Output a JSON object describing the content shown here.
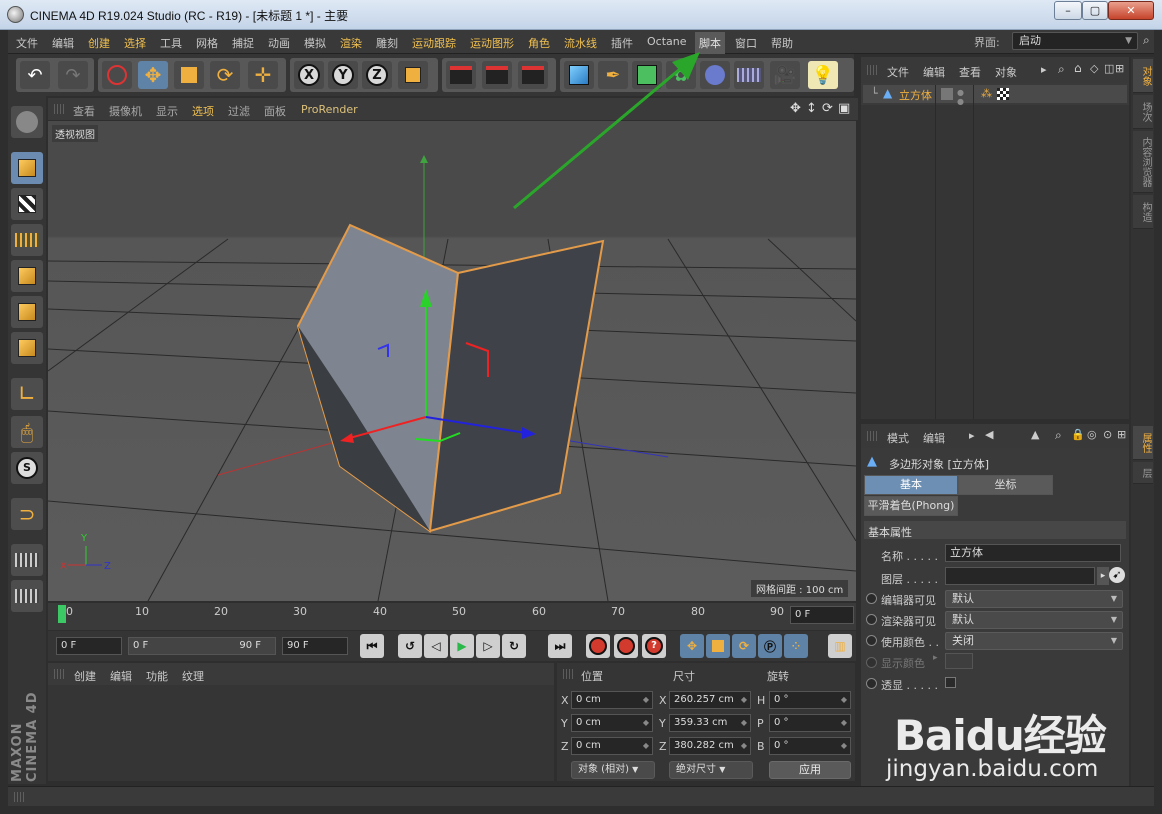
{
  "window": {
    "title": "CINEMA 4D R19.024 Studio (RC - R19) - [未标题 1 *] - 主要",
    "minimize": "–",
    "maximize": "▢",
    "close": "✕"
  },
  "menubar": {
    "items": [
      "文件",
      "编辑",
      "创建",
      "选择",
      "工具",
      "网格",
      "捕捉",
      "动画",
      "模拟",
      "渲染",
      "雕刻",
      "运动跟踪",
      "运动图形",
      "角色",
      "流水线",
      "插件",
      "Octane",
      "脚本",
      "窗口",
      "帮助"
    ],
    "layout_label": "界面:",
    "layout_value": "启动"
  },
  "viewport": {
    "menu": [
      "查看",
      "摄像机",
      "显示",
      "选项",
      "过滤",
      "面板",
      "ProRender"
    ],
    "label": "透视视图",
    "grid_spacing": "网格间距 : 100 cm",
    "axis_labels": {
      "y": "Y",
      "x": "X",
      "z": "Z"
    }
  },
  "timeline": {
    "ticks": [
      "0",
      "10",
      "20",
      "30",
      "40",
      "50",
      "60",
      "70",
      "80",
      "90"
    ],
    "current_frame": "0 F"
  },
  "playback": {
    "start": "0 F",
    "range_start": "0 F",
    "range_end": "90 F",
    "end": "90 F"
  },
  "material_manager": {
    "menu": [
      "创建",
      "编辑",
      "功能",
      "纹理"
    ]
  },
  "coordinates": {
    "headers": [
      "位置",
      "尺寸",
      "旋转"
    ],
    "rows": [
      {
        "pos_axis": "X",
        "pos": "0 cm",
        "size_axis": "X",
        "size": "260.257 cm",
        "rot_axis": "H",
        "rot": "0 °"
      },
      {
        "pos_axis": "Y",
        "pos": "0 cm",
        "size_axis": "Y",
        "size": "359.33 cm",
        "rot_axis": "P",
        "rot": "0 °"
      },
      {
        "pos_axis": "Z",
        "pos": "0 cm",
        "size_axis": "Z",
        "size": "380.282 cm",
        "rot_axis": "B",
        "rot": "0 °"
      }
    ],
    "mode": "对象 (相对)",
    "size_mode": "绝对尺寸",
    "apply": "应用"
  },
  "object_manager": {
    "menu": [
      "文件",
      "编辑",
      "查看",
      "对象"
    ],
    "object_name": "立方体"
  },
  "attribute_manager": {
    "menu": [
      "模式",
      "编辑"
    ],
    "object_type": "多边形对象 [立方体]",
    "tabs": [
      "基本",
      "坐标"
    ],
    "phong_tab": "平滑着色(Phong)",
    "section": "基本属性",
    "fields": {
      "name_label": "名称 . . . . .",
      "name_value": "立方体",
      "layer_label": "图层 . . . . .",
      "editor_vis_label": "编辑器可见",
      "editor_vis_value": "默认",
      "render_vis_label": "渲染器可见",
      "render_vis_value": "默认",
      "use_color_label": "使用颜色 . .",
      "use_color_value": "关闭",
      "display_color_label": "显示颜色",
      "xray_label": "透显 . . . . ."
    }
  },
  "right_tabs": [
    "对象",
    "场次",
    "内容浏览器",
    "构造",
    "属性",
    "层"
  ],
  "logo": "MAXON CINEMA 4D",
  "watermark": {
    "brand": "Baidu经验",
    "url": "jingyan.baidu.com"
  },
  "colors": {
    "accent": "#f0b040",
    "selection": "#6b8cb0",
    "arrow": "#2aa62a"
  }
}
